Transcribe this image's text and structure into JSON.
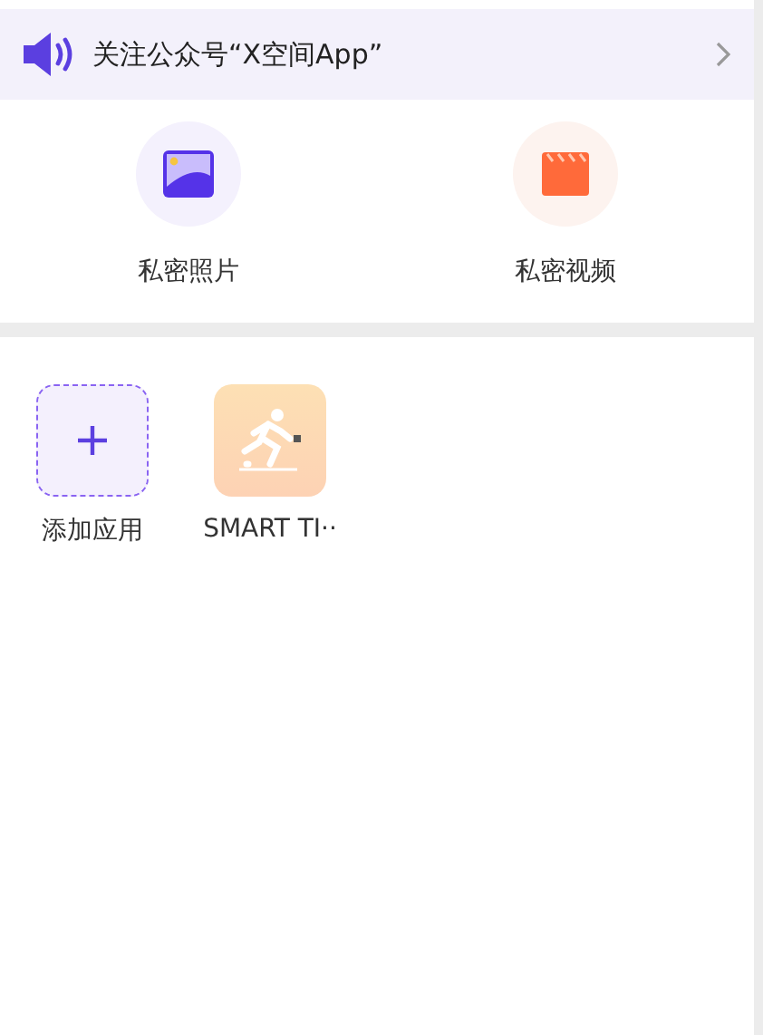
{
  "banner": {
    "text": "关注公众号“X空间App”"
  },
  "shortcuts": [
    {
      "label": "私密照片",
      "kind": "photo"
    },
    {
      "label": "私密视频",
      "kind": "video"
    }
  ],
  "apps": [
    {
      "label": "添加应用",
      "kind": "add"
    },
    {
      "label": "SMART TI··",
      "kind": "app"
    }
  ]
}
